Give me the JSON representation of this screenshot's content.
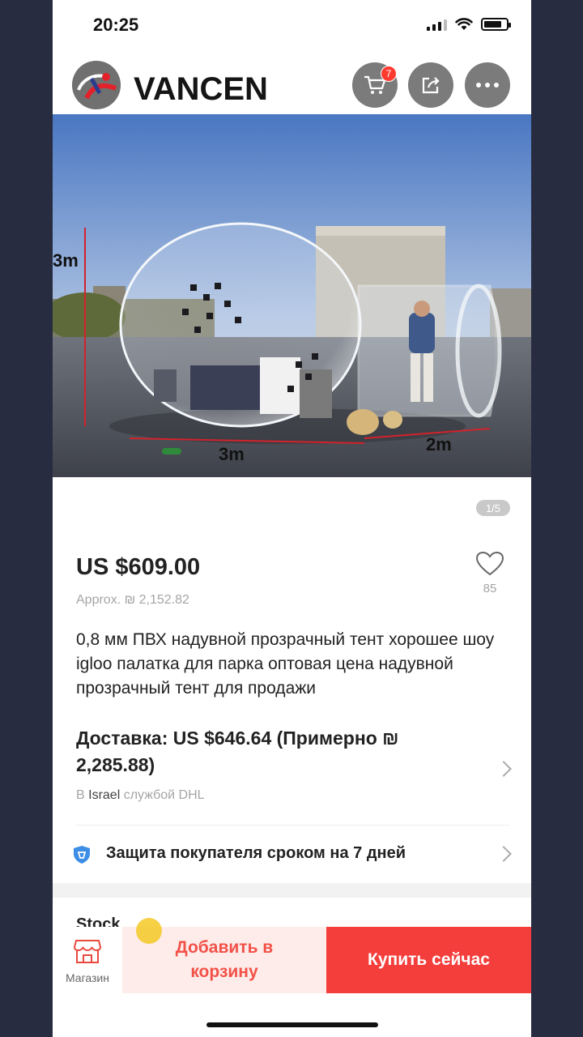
{
  "status": {
    "time": "20:25"
  },
  "header": {
    "brand": "VANCEN",
    "cart_count": "7"
  },
  "image": {
    "dims": [
      "3m",
      "3m",
      "2m"
    ],
    "counter": "1/5"
  },
  "product": {
    "price": "US $609.00",
    "approx": "Approx. ₪ 2,152.82",
    "wish_count": "85",
    "title": "0,8 мм ПВХ надувной прозрачный тент хорошее шоу igloo палатка для парка оптовая цена надувной прозрачный тент для продажи"
  },
  "delivery": {
    "line": "Доставка: US $646.64 (Примерно ₪ 2,285.88)",
    "prefix": "В",
    "country": "Israel",
    "service": "службой DHL"
  },
  "protection": {
    "text": "Защита покупателя сроком на 7 дней"
  },
  "stock_peek": "Stock",
  "bottom": {
    "store_label": "Магазин",
    "add_to_cart": "Добавить в корзину",
    "buy_now": "Купить сейчас"
  },
  "colors": {
    "accent": "#f43e3c",
    "accent_light": "#fdecea",
    "shield": "#3d8ee6"
  },
  "icons": [
    "cart-icon",
    "share-icon",
    "more-icon",
    "heart-icon",
    "shield-icon",
    "store-icon",
    "chevron-right-icon"
  ]
}
